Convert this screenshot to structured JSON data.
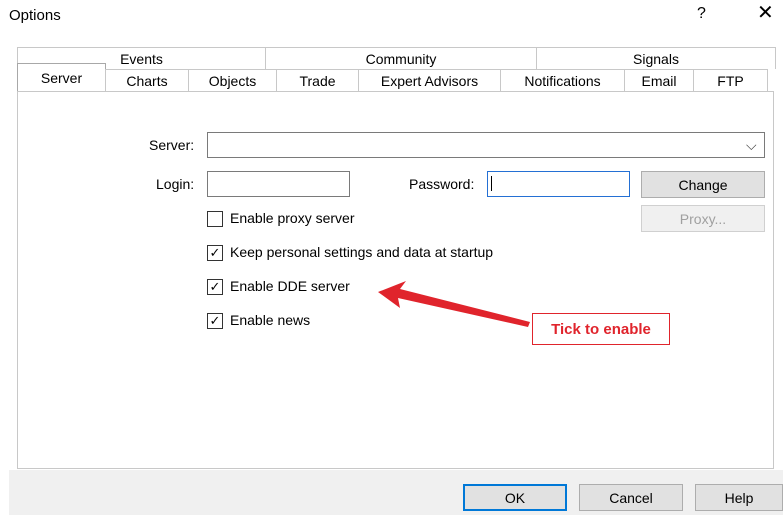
{
  "window": {
    "title": "Options",
    "help_glyph": "?",
    "close_glyph": "✕"
  },
  "tabs": {
    "row1": [
      {
        "label": "Events",
        "w": 249
      },
      {
        "label": "Community",
        "w": 272
      },
      {
        "label": "Signals",
        "w": 240
      }
    ],
    "row2": [
      {
        "label": "Server",
        "w": 89,
        "active": true
      },
      {
        "label": "Charts",
        "w": 84
      },
      {
        "label": "Objects",
        "w": 89
      },
      {
        "label": "Trade",
        "w": 83
      },
      {
        "label": "Expert Advisors",
        "w": 143
      },
      {
        "label": "Notifications",
        "w": 125
      },
      {
        "label": "Email",
        "w": 70
      },
      {
        "label": "FTP",
        "w": 75
      }
    ]
  },
  "form": {
    "server_label": "Server:",
    "server_value": "",
    "login_label": "Login:",
    "login_value": "",
    "password_label": "Password:",
    "password_value": "",
    "change_label": "Change",
    "proxy_label": "Proxy...",
    "checkboxes": [
      {
        "label": "Enable proxy server",
        "checked": false
      },
      {
        "label": "Keep personal settings and data at startup",
        "checked": true
      },
      {
        "label": "Enable DDE server",
        "checked": true
      },
      {
        "label": "Enable news",
        "checked": true
      }
    ]
  },
  "annotation": {
    "text": "Tick to enable",
    "color": "#e0242c"
  },
  "footer": {
    "ok": "OK",
    "cancel": "Cancel",
    "help": "Help"
  }
}
